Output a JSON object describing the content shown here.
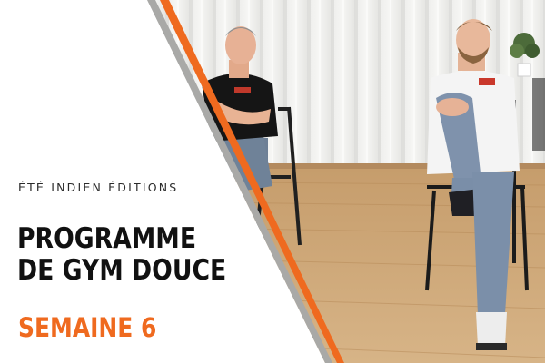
{
  "cover": {
    "publisher": "ÉTÉ INDIEN ÉDITIONS",
    "title_line_1": "PROGRAMME",
    "title_line_2": "DE GYM DOUCE",
    "week_label": "SEMAINE 6"
  },
  "colors": {
    "accent": "#ef6a1f",
    "title_text": "#111111",
    "panel_background": "#ffffff"
  }
}
